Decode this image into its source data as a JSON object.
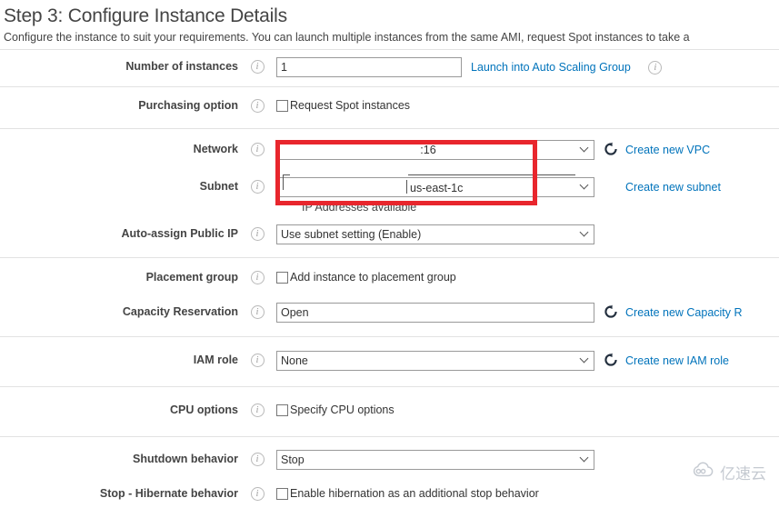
{
  "header": {
    "title": "Step 3: Configure Instance Details",
    "description": "Configure the instance to suit your requirements. You can launch multiple instances from the same AMI, request Spot instances to take a"
  },
  "icons": {
    "info": "i",
    "refresh": "refresh-icon",
    "chevron": "chevron-down-icon"
  },
  "form": {
    "number_of_instances": {
      "label": "Number of instances",
      "value": "1",
      "link": "Launch into Auto Scaling Group"
    },
    "purchasing_option": {
      "label": "Purchasing option",
      "checkbox_label": "Request Spot instances",
      "checked": false
    },
    "network": {
      "label": "Network",
      "value": ":16",
      "link": "Create new VPC"
    },
    "subnet": {
      "label": "Subnet",
      "value": "us-east-1c",
      "note": "IP Addresses available",
      "link": "Create new subnet"
    },
    "auto_assign_public_ip": {
      "label": "Auto-assign Public IP",
      "value": "Use subnet setting (Enable)"
    },
    "placement_group": {
      "label": "Placement group",
      "checkbox_label": "Add instance to placement group",
      "checked": false
    },
    "capacity_reservation": {
      "label": "Capacity Reservation",
      "value": "Open",
      "link": "Create new Capacity R"
    },
    "iam_role": {
      "label": "IAM role",
      "value": "None",
      "link": "Create new IAM role"
    },
    "cpu_options": {
      "label": "CPU options",
      "checkbox_label": "Specify CPU options",
      "checked": false
    },
    "shutdown_behavior": {
      "label": "Shutdown behavior",
      "value": "Stop"
    },
    "stop_hibernate_behavior": {
      "label": "Stop - Hibernate behavior",
      "checkbox_label": "Enable hibernation as an additional stop behavior",
      "checked": false
    }
  },
  "annotation": {
    "color": "#e8262d"
  },
  "watermark": {
    "text": "亿速云"
  }
}
